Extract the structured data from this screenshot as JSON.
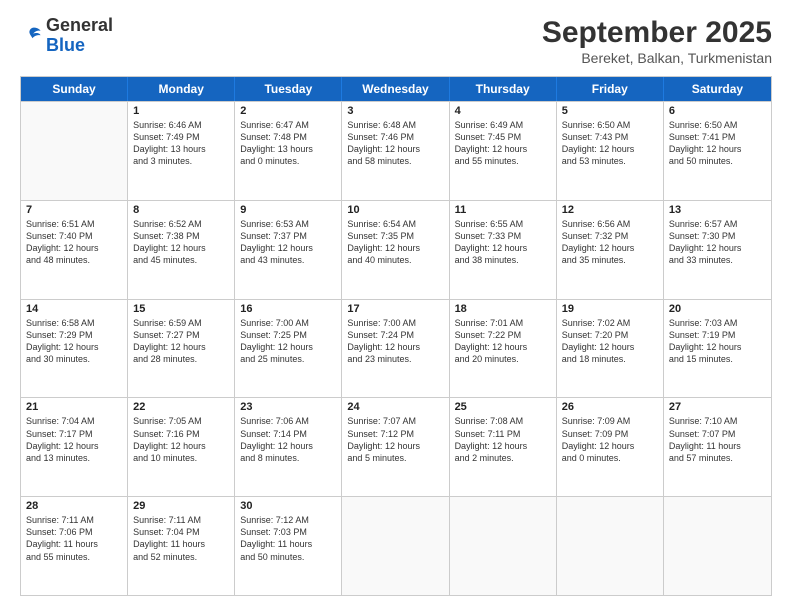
{
  "logo": {
    "general": "General",
    "blue": "Blue"
  },
  "title": {
    "month_year": "September 2025",
    "location": "Bereket, Balkan, Turkmenistan"
  },
  "header_days": [
    "Sunday",
    "Monday",
    "Tuesday",
    "Wednesday",
    "Thursday",
    "Friday",
    "Saturday"
  ],
  "weeks": [
    [
      {
        "day": "",
        "empty": true
      },
      {
        "day": "1",
        "sunrise": "Sunrise: 6:46 AM",
        "sunset": "Sunset: 7:49 PM",
        "daylight": "Daylight: 13 hours and 3 minutes."
      },
      {
        "day": "2",
        "sunrise": "Sunrise: 6:47 AM",
        "sunset": "Sunset: 7:48 PM",
        "daylight": "Daylight: 13 hours and 0 minutes."
      },
      {
        "day": "3",
        "sunrise": "Sunrise: 6:48 AM",
        "sunset": "Sunset: 7:46 PM",
        "daylight": "Daylight: 12 hours and 58 minutes."
      },
      {
        "day": "4",
        "sunrise": "Sunrise: 6:49 AM",
        "sunset": "Sunset: 7:45 PM",
        "daylight": "Daylight: 12 hours and 55 minutes."
      },
      {
        "day": "5",
        "sunrise": "Sunrise: 6:50 AM",
        "sunset": "Sunset: 7:43 PM",
        "daylight": "Daylight: 12 hours and 53 minutes."
      },
      {
        "day": "6",
        "sunrise": "Sunrise: 6:50 AM",
        "sunset": "Sunset: 7:41 PM",
        "daylight": "Daylight: 12 hours and 50 minutes."
      }
    ],
    [
      {
        "day": "7",
        "sunrise": "Sunrise: 6:51 AM",
        "sunset": "Sunset: 7:40 PM",
        "daylight": "Daylight: 12 hours and 48 minutes."
      },
      {
        "day": "8",
        "sunrise": "Sunrise: 6:52 AM",
        "sunset": "Sunset: 7:38 PM",
        "daylight": "Daylight: 12 hours and 45 minutes."
      },
      {
        "day": "9",
        "sunrise": "Sunrise: 6:53 AM",
        "sunset": "Sunset: 7:37 PM",
        "daylight": "Daylight: 12 hours and 43 minutes."
      },
      {
        "day": "10",
        "sunrise": "Sunrise: 6:54 AM",
        "sunset": "Sunset: 7:35 PM",
        "daylight": "Daylight: 12 hours and 40 minutes."
      },
      {
        "day": "11",
        "sunrise": "Sunrise: 6:55 AM",
        "sunset": "Sunset: 7:33 PM",
        "daylight": "Daylight: 12 hours and 38 minutes."
      },
      {
        "day": "12",
        "sunrise": "Sunrise: 6:56 AM",
        "sunset": "Sunset: 7:32 PM",
        "daylight": "Daylight: 12 hours and 35 minutes."
      },
      {
        "day": "13",
        "sunrise": "Sunrise: 6:57 AM",
        "sunset": "Sunset: 7:30 PM",
        "daylight": "Daylight: 12 hours and 33 minutes."
      }
    ],
    [
      {
        "day": "14",
        "sunrise": "Sunrise: 6:58 AM",
        "sunset": "Sunset: 7:29 PM",
        "daylight": "Daylight: 12 hours and 30 minutes."
      },
      {
        "day": "15",
        "sunrise": "Sunrise: 6:59 AM",
        "sunset": "Sunset: 7:27 PM",
        "daylight": "Daylight: 12 hours and 28 minutes."
      },
      {
        "day": "16",
        "sunrise": "Sunrise: 7:00 AM",
        "sunset": "Sunset: 7:25 PM",
        "daylight": "Daylight: 12 hours and 25 minutes."
      },
      {
        "day": "17",
        "sunrise": "Sunrise: 7:00 AM",
        "sunset": "Sunset: 7:24 PM",
        "daylight": "Daylight: 12 hours and 23 minutes."
      },
      {
        "day": "18",
        "sunrise": "Sunrise: 7:01 AM",
        "sunset": "Sunset: 7:22 PM",
        "daylight": "Daylight: 12 hours and 20 minutes."
      },
      {
        "day": "19",
        "sunrise": "Sunrise: 7:02 AM",
        "sunset": "Sunset: 7:20 PM",
        "daylight": "Daylight: 12 hours and 18 minutes."
      },
      {
        "day": "20",
        "sunrise": "Sunrise: 7:03 AM",
        "sunset": "Sunset: 7:19 PM",
        "daylight": "Daylight: 12 hours and 15 minutes."
      }
    ],
    [
      {
        "day": "21",
        "sunrise": "Sunrise: 7:04 AM",
        "sunset": "Sunset: 7:17 PM",
        "daylight": "Daylight: 12 hours and 13 minutes."
      },
      {
        "day": "22",
        "sunrise": "Sunrise: 7:05 AM",
        "sunset": "Sunset: 7:16 PM",
        "daylight": "Daylight: 12 hours and 10 minutes."
      },
      {
        "day": "23",
        "sunrise": "Sunrise: 7:06 AM",
        "sunset": "Sunset: 7:14 PM",
        "daylight": "Daylight: 12 hours and 8 minutes."
      },
      {
        "day": "24",
        "sunrise": "Sunrise: 7:07 AM",
        "sunset": "Sunset: 7:12 PM",
        "daylight": "Daylight: 12 hours and 5 minutes."
      },
      {
        "day": "25",
        "sunrise": "Sunrise: 7:08 AM",
        "sunset": "Sunset: 7:11 PM",
        "daylight": "Daylight: 12 hours and 2 minutes."
      },
      {
        "day": "26",
        "sunrise": "Sunrise: 7:09 AM",
        "sunset": "Sunset: 7:09 PM",
        "daylight": "Daylight: 12 hours and 0 minutes."
      },
      {
        "day": "27",
        "sunrise": "Sunrise: 7:10 AM",
        "sunset": "Sunset: 7:07 PM",
        "daylight": "Daylight: 11 hours and 57 minutes."
      }
    ],
    [
      {
        "day": "28",
        "sunrise": "Sunrise: 7:11 AM",
        "sunset": "Sunset: 7:06 PM",
        "daylight": "Daylight: 11 hours and 55 minutes."
      },
      {
        "day": "29",
        "sunrise": "Sunrise: 7:11 AM",
        "sunset": "Sunset: 7:04 PM",
        "daylight": "Daylight: 11 hours and 52 minutes."
      },
      {
        "day": "30",
        "sunrise": "Sunrise: 7:12 AM",
        "sunset": "Sunset: 7:03 PM",
        "daylight": "Daylight: 11 hours and 50 minutes."
      },
      {
        "day": "",
        "empty": true
      },
      {
        "day": "",
        "empty": true
      },
      {
        "day": "",
        "empty": true
      },
      {
        "day": "",
        "empty": true
      }
    ]
  ]
}
